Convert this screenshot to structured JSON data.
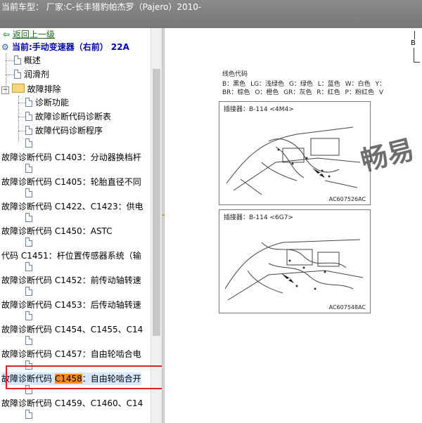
{
  "title_bar": {
    "text": "当前车型： 厂家:C-长丰猎豹帕杰罗（Pajero）2010-"
  },
  "tree": {
    "back_label": "返回上一级",
    "current_label": "当前:手动变速器（右前） 22A",
    "items": [
      {
        "label": "概述"
      },
      {
        "label": "润滑剂"
      },
      {
        "label": "故障排除"
      },
      {
        "label": "诊断功能"
      },
      {
        "label": "故障诊断代码诊断表"
      },
      {
        "label": "故障代码诊断程序"
      }
    ],
    "codes": [
      "故障诊断代码 C1403：分动器换档杆",
      "故障诊断代码 C1405：轮胎直径不同",
      "故障诊断代码 C1422、C1423：供电",
      "故障诊断代码 C1450：ASTC",
      "代码 C1451：杆位置传感器系统（输",
      "故障诊断代码 C1452：前传动轴转速",
      "故障诊断代码 C1453：后传动轴转速",
      "故障诊断代码 C1454、C1455、C14",
      "故障诊断代码 C1457：自由轮啮合电"
    ],
    "selected": {
      "prefix": "故障诊断代码 ",
      "highlight": "C1458",
      "suffix": "：自由轮啮合开"
    },
    "last_code": "故障诊断代码 C1459、C1460、C14"
  },
  "content": {
    "connector_top_label": "B",
    "wire_color_title": "线色代码",
    "wire_colors_row1": [
      "B：黑色",
      "LG：浅绿色",
      "G：绿色",
      "L：蓝色",
      "W：白色",
      "Y："
    ],
    "wire_colors_row2": [
      "BR：棕色",
      "O：橙色",
      "GR：灰色",
      "R：红色",
      "P：粉红色",
      "V"
    ],
    "watermark": "畅易",
    "figure1": {
      "label": "插接器：B-114 <4M4>",
      "code": "AC607526AC"
    },
    "figure2": {
      "label": "插接器：B-114 <6G7>",
      "code": "AC607548AC"
    }
  }
}
